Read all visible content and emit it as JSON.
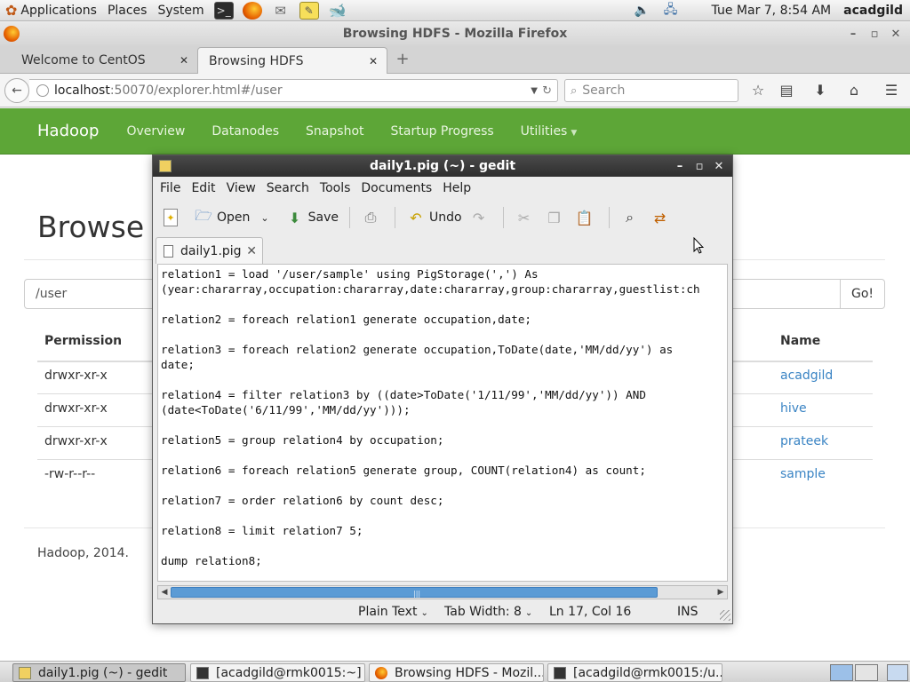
{
  "top_panel": {
    "menus": [
      "Applications",
      "Places",
      "System"
    ],
    "clock": "Tue Mar  7,  8:54 AM",
    "user": "acadgild"
  },
  "firefox": {
    "window_title": "Browsing HDFS - Mozilla Firefox",
    "tabs": [
      {
        "label": "Welcome to CentOS"
      },
      {
        "label": "Browsing HDFS"
      }
    ],
    "url_host": "localhost",
    "url_rest": ":50070/explorer.html#/user",
    "search_placeholder": "Search"
  },
  "hadoop": {
    "brand": "Hadoop",
    "nav": [
      "Overview",
      "Datanodes",
      "Snapshot",
      "Startup Progress",
      "Utilities"
    ],
    "page_title": "Browse",
    "path": "/user",
    "go_label": "Go!",
    "columns": {
      "permission": "Permission",
      "name": "Name"
    },
    "rows": [
      {
        "permission": "drwxr-xr-x",
        "name": "acadgild"
      },
      {
        "permission": "drwxr-xr-x",
        "name": "hive"
      },
      {
        "permission": "drwxr-xr-x",
        "name": "prateek"
      },
      {
        "permission": "-rw-r--r--",
        "name": "sample"
      }
    ],
    "footer": "Hadoop, 2014."
  },
  "gedit": {
    "title": "daily1.pig (~) - gedit",
    "menu": [
      "File",
      "Edit",
      "View",
      "Search",
      "Tools",
      "Documents",
      "Help"
    ],
    "toolbar": {
      "open": "Open",
      "save": "Save",
      "undo": "Undo"
    },
    "doc_tab": "daily1.pig",
    "code_lines": [
      "relation1 = load '/user/sample' using PigStorage(',') As",
      "(year:chararray,occupation:chararray,date:chararray,group:chararray,guestlist:ch",
      "",
      "relation2 = foreach relation1 generate occupation,date;",
      "",
      "relation3 = foreach relation2 generate occupation,ToDate(date,'MM/dd/yy') as",
      "date;",
      "",
      "relation4 = filter relation3 by ((date>ToDate('1/11/99','MM/dd/yy')) AND",
      "(date<ToDate('6/11/99','MM/dd/yy')));",
      "",
      "relation5 = group relation4 by occupation;",
      "",
      "relation6 = foreach relation5 generate group, COUNT(relation4) as count;",
      "",
      "relation7 = order relation6 by count desc;",
      "",
      "relation8 = limit relation7 5;",
      "",
      "dump relation8;"
    ],
    "status": {
      "syntax": "Plain Text",
      "tab_width": "Tab Width:  8",
      "position": "Ln 17, Col 16",
      "mode": "INS"
    }
  },
  "taskbar": {
    "tasks": [
      {
        "label": "daily1.pig (~) - gedit"
      },
      {
        "label": "[acadgild@rmk0015:~]"
      },
      {
        "label": "Browsing HDFS - Mozil..."
      },
      {
        "label": "[acadgild@rmk0015:/u..."
      }
    ]
  }
}
